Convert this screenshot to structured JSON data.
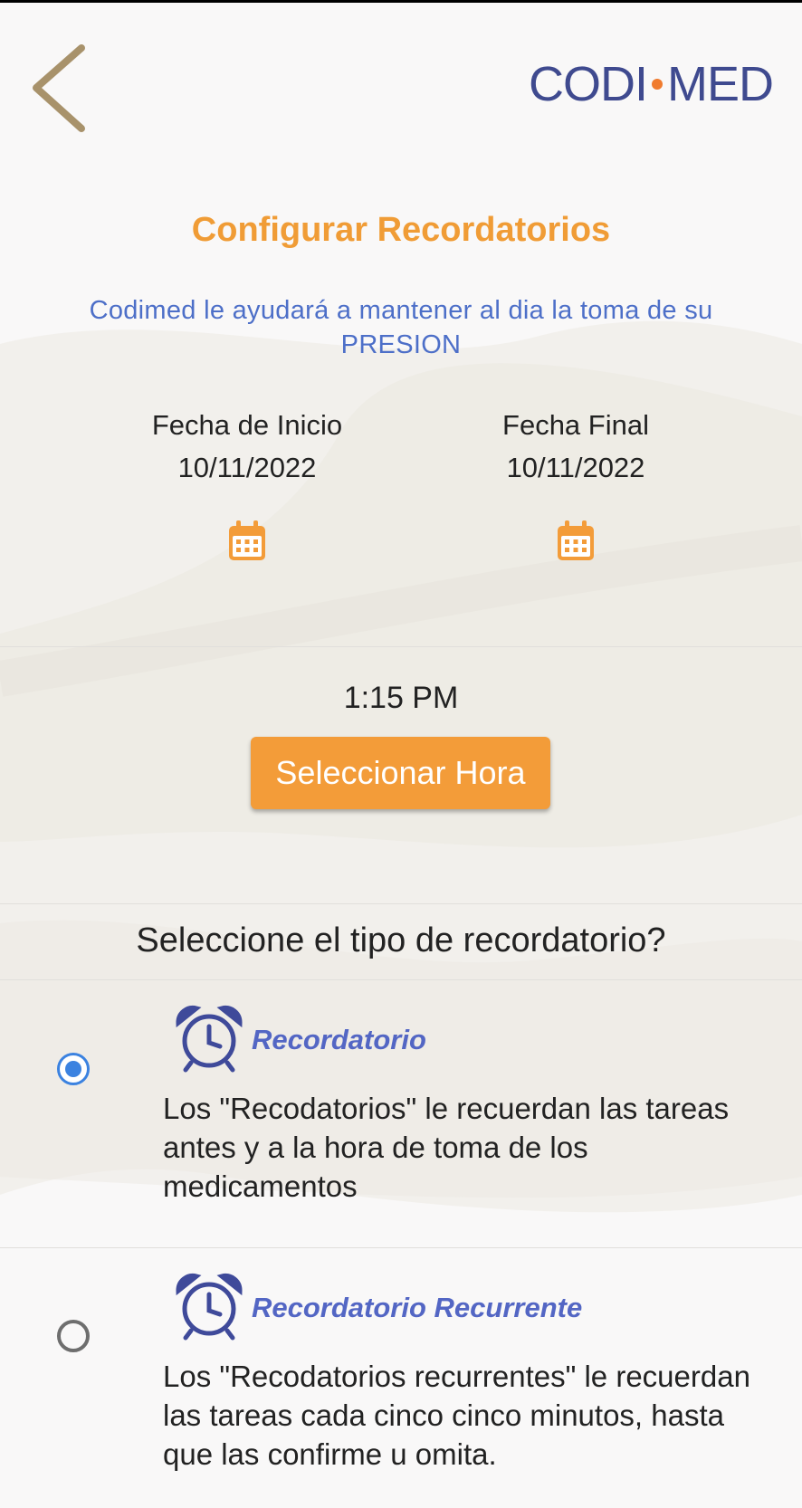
{
  "header": {
    "back_icon": "chevron-left-icon",
    "logo": {
      "left": "CODI",
      "right": "MED"
    }
  },
  "title": "Configurar Recordatorios",
  "subtitle": "Codimed le ayudará a mantener al dia la toma de su PRESION",
  "dates": {
    "start": {
      "label": "Fecha de Inicio",
      "value": "10/11/2022"
    },
    "end": {
      "label": "Fecha Final",
      "value": "10/11/2022"
    }
  },
  "time": {
    "value": "1:15 PM",
    "button_label": "Seleccionar Hora"
  },
  "question": "Seleccione el tipo de recordatorio?",
  "options": [
    {
      "title": "Recordatorio",
      "description": "Los \"Recodatorios\" le recuerdan las tareas antes y a la hora de toma de los medicamentos",
      "selected": true
    },
    {
      "title": "Recordatorio Recurrente",
      "description": "Los \"Recodatorios recurrentes\" le recuerdan las tareas cada cinco cinco minutos, hasta que las confirme u omita.",
      "selected": false
    }
  ],
  "colors": {
    "accent": "#f39c39",
    "title": "#f09c36",
    "subtitle": "#4d6fc8",
    "option_title": "#5366c4",
    "logo": "#3f4a8f",
    "radio_selected": "#3b82e0"
  }
}
